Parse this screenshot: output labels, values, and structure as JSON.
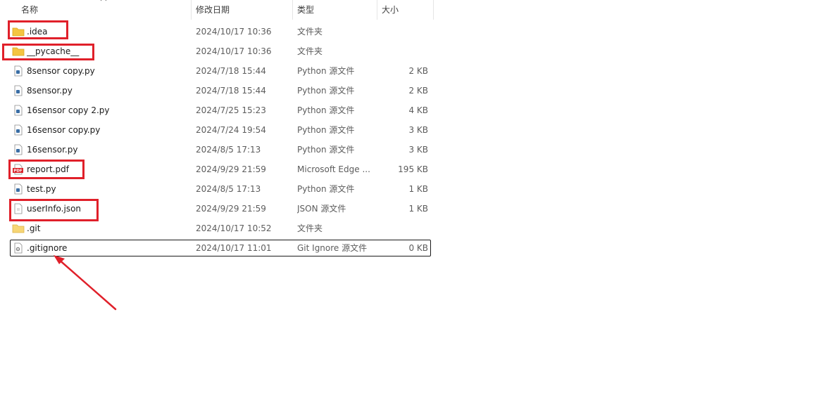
{
  "columns": {
    "name": "名称",
    "date": "修改日期",
    "type": "类型",
    "size": "大小"
  },
  "files": [
    {
      "name": ".idea",
      "date": "2024/10/17 10:36",
      "type": "文件夹",
      "size": "",
      "icon": "folder-icon"
    },
    {
      "name": "__pycache__",
      "date": "2024/10/17 10:36",
      "type": "文件夹",
      "size": "",
      "icon": "folder-icon"
    },
    {
      "name": "8sensor copy.py",
      "date": "2024/7/18 15:44",
      "type": "Python 源文件",
      "size": "2 KB",
      "icon": "python-file-icon"
    },
    {
      "name": "8sensor.py",
      "date": "2024/7/18 15:44",
      "type": "Python 源文件",
      "size": "2 KB",
      "icon": "python-file-icon"
    },
    {
      "name": "16sensor copy 2.py",
      "date": "2024/7/25 15:23",
      "type": "Python 源文件",
      "size": "4 KB",
      "icon": "python-file-icon"
    },
    {
      "name": "16sensor copy.py",
      "date": "2024/7/24 19:54",
      "type": "Python 源文件",
      "size": "3 KB",
      "icon": "python-file-icon"
    },
    {
      "name": "16sensor.py",
      "date": "2024/8/5 17:13",
      "type": "Python 源文件",
      "size": "3 KB",
      "icon": "python-file-icon"
    },
    {
      "name": "report.pdf",
      "date": "2024/9/29 21:59",
      "type": "Microsoft Edge ...",
      "size": "195 KB",
      "icon": "pdf-file-icon"
    },
    {
      "name": "test.py",
      "date": "2024/8/5 17:13",
      "type": "Python 源文件",
      "size": "1 KB",
      "icon": "python-file-icon"
    },
    {
      "name": "userInfo.json",
      "date": "2024/9/29 21:59",
      "type": "JSON 源文件",
      "size": "1 KB",
      "icon": "json-file-icon"
    },
    {
      "name": ".git",
      "date": "2024/10/17 10:52",
      "type": "文件夹",
      "size": "",
      "icon": "folder-icon"
    },
    {
      "name": ".gitignore",
      "date": "2024/10/17 11:01",
      "type": "Git Ignore 源文件",
      "size": "0 KB",
      "icon": "gitignore-file-icon"
    }
  ],
  "colors": {
    "annotation_red": "#e0202a",
    "folder_yellow": "#f4c542",
    "pdf_red": "#d9232a",
    "python_blue": "#3a6ea5"
  }
}
